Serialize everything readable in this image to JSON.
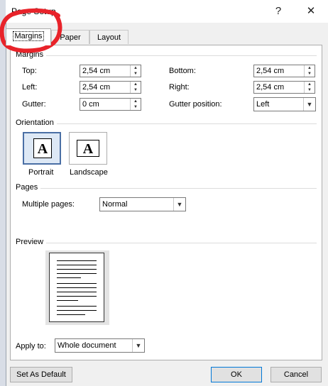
{
  "title": "Page Setup",
  "titlebar": {
    "help": "?",
    "close": "✕"
  },
  "tabs": [
    {
      "label": "Margins",
      "active": true
    },
    {
      "label": "Paper",
      "active": false
    },
    {
      "label": "Layout",
      "active": false
    }
  ],
  "margins": {
    "group_label": "Margins",
    "top": {
      "label": "Top:",
      "value": "2,54 cm"
    },
    "left": {
      "label": "Left:",
      "value": "2,54 cm"
    },
    "gutter": {
      "label": "Gutter:",
      "value": "0 cm"
    },
    "bottom": {
      "label": "Bottom:",
      "value": "2,54 cm"
    },
    "right": {
      "label": "Right:",
      "value": "2,54 cm"
    },
    "gutter_position": {
      "label": "Gutter position:",
      "value": "Left"
    }
  },
  "orientation": {
    "group_label": "Orientation",
    "portrait": {
      "label": "Portrait",
      "selected": true
    },
    "landscape": {
      "label": "Landscape",
      "selected": false
    },
    "icon_letter": "A"
  },
  "pages": {
    "group_label": "Pages",
    "multiple_pages_label": "Multiple pages:",
    "multiple_pages_value": "Normal"
  },
  "preview": {
    "group_label": "Preview"
  },
  "apply": {
    "label": "Apply to:",
    "value": "Whole document"
  },
  "buttons": {
    "set_default": "Set As Default",
    "ok": "OK",
    "cancel": "Cancel"
  },
  "colors": {
    "annotation": "#e8232a",
    "selection": "#4a6fa5",
    "dialog_bg": "#f0f0f0"
  }
}
